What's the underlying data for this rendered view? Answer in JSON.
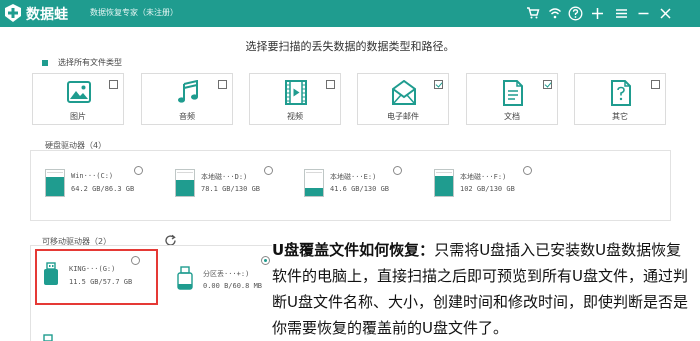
{
  "app": {
    "name": "数据蛙",
    "subtitle": "数据恢复专家（未注册）"
  },
  "titlebar_icons": [
    "cart-icon",
    "wifi-icon",
    "help-icon",
    "plus-icon",
    "minimize-icon",
    "close-icon"
  ],
  "colors": {
    "accent": "#1f9c8f",
    "highlight": "#e53935"
  },
  "prompt": "选择要扫描的丢失数据的数据类型和路径。",
  "select_all_label": "选择所有文件类型",
  "file_types": [
    {
      "label": "图片",
      "checked": false,
      "icon": "image-icon"
    },
    {
      "label": "音频",
      "checked": false,
      "icon": "music-icon"
    },
    {
      "label": "视频",
      "checked": false,
      "icon": "video-icon"
    },
    {
      "label": "电子邮件",
      "checked": true,
      "icon": "mail-icon"
    },
    {
      "label": "文档",
      "checked": true,
      "icon": "document-icon"
    },
    {
      "label": "其它",
      "checked": false,
      "icon": "other-icon"
    }
  ],
  "hard_drives": {
    "title": "硬盘驱动器（4）",
    "items": [
      {
        "name": "Win···(C:)",
        "size": "64.2 GB/86.3 GB",
        "used_fraction": 0.74
      },
      {
        "name": "本地磁···D:)",
        "size": "78.1 GB/130 GB",
        "used_fraction": 0.6
      },
      {
        "name": "本地磁···E:)",
        "size": "41.6 GB/130 GB",
        "used_fraction": 0.32
      },
      {
        "name": "本地磁···F:)",
        "size": "102 GB/130 GB",
        "used_fraction": 0.78
      }
    ]
  },
  "removable_drives": {
    "title": "可移动驱动器（2）",
    "items": [
      {
        "name": "KING···(G:)",
        "size": "11.5 GB/57.7 GB"
      },
      {
        "name": "分区丢···+:)",
        "size": "0.00 B/60.8 MB"
      }
    ]
  },
  "overlay": {
    "heading": "U盘覆盖文件如何恢复：",
    "body": "只需将U盘插入已安装数U盘数据恢复软件的电脑上，直接扫描之后即可预览到所有U盘文件，通过判断U盘文件名称、大小，创建时间和修改时间，即使判断是否是你需要恢复的覆盖前的U盘文件了。"
  }
}
